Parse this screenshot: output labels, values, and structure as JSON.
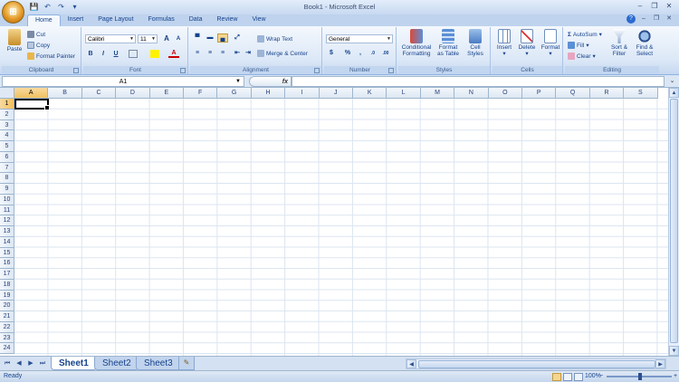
{
  "window": {
    "title": "Book1 - Microsoft Excel",
    "min": "–",
    "max": "❐",
    "close": "✕"
  },
  "qat": {
    "save": "💾",
    "undo": "↶",
    "redo": "↷",
    "customize": "▾"
  },
  "office_button": "⊞",
  "tabs": [
    {
      "label": "Home",
      "active": true
    },
    {
      "label": "Insert"
    },
    {
      "label": "Page Layout"
    },
    {
      "label": "Formulas"
    },
    {
      "label": "Data"
    },
    {
      "label": "Review"
    },
    {
      "label": "View"
    }
  ],
  "help": {
    "help": "?",
    "min": "–",
    "restore": "❐",
    "close": "✕"
  },
  "ribbon": {
    "clipboard": {
      "label": "Clipboard",
      "paste": "Paste",
      "cut": "Cut",
      "copy": "Copy",
      "format_painter": "Format Painter"
    },
    "font": {
      "label": "Font",
      "name": "Calibri",
      "size": "11",
      "grow": "A",
      "shrink": "A",
      "bold": "B",
      "italic": "I",
      "underline": "U"
    },
    "alignment": {
      "label": "Alignment",
      "wrap_text": "Wrap Text",
      "merge_center": "Merge & Center"
    },
    "number": {
      "label": "Number",
      "format": "General",
      "currency": "$",
      "percent": "%",
      "comma": ",",
      "inc_decimal": ".0",
      "dec_decimal": ".00"
    },
    "styles": {
      "label": "Styles",
      "conditional_1": "Conditional",
      "conditional_2": "Formatting",
      "format_table_1": "Format",
      "format_table_2": "as Table",
      "cell_styles_1": "Cell",
      "cell_styles_2": "Styles"
    },
    "cells": {
      "label": "Cells",
      "insert": "Insert",
      "delete": "Delete",
      "format": "Format"
    },
    "editing": {
      "label": "Editing",
      "autosum": "AutoSum",
      "fill": "Fill",
      "clear": "Clear",
      "sort_filter_1": "Sort &",
      "sort_filter_2": "Filter",
      "find_select_1": "Find &",
      "find_select_2": "Select"
    }
  },
  "formula_bar": {
    "name_box": "A1",
    "fx": "fx",
    "formula": ""
  },
  "grid": {
    "columns": [
      "A",
      "B",
      "C",
      "D",
      "E",
      "F",
      "G",
      "H",
      "I",
      "J",
      "K",
      "L",
      "M",
      "N",
      "O",
      "P",
      "Q",
      "R",
      "S"
    ],
    "rows": [
      "1",
      "2",
      "3",
      "4",
      "5",
      "6",
      "7",
      "8",
      "9",
      "10",
      "11",
      "12",
      "13",
      "14",
      "15",
      "16",
      "17",
      "18",
      "19",
      "20",
      "21",
      "22",
      "23",
      "24"
    ],
    "active_cell": "A1"
  },
  "sheets": [
    {
      "label": "Sheet1",
      "active": true
    },
    {
      "label": "Sheet2"
    },
    {
      "label": "Sheet3"
    }
  ],
  "status": {
    "ready": "Ready",
    "zoom": "100%",
    "zoom_minus": "−",
    "zoom_plus": "+"
  },
  "colors": {
    "ribbon_bg": "#dce8f7",
    "accent": "#15428b",
    "selected_header": "#f1c15f"
  }
}
